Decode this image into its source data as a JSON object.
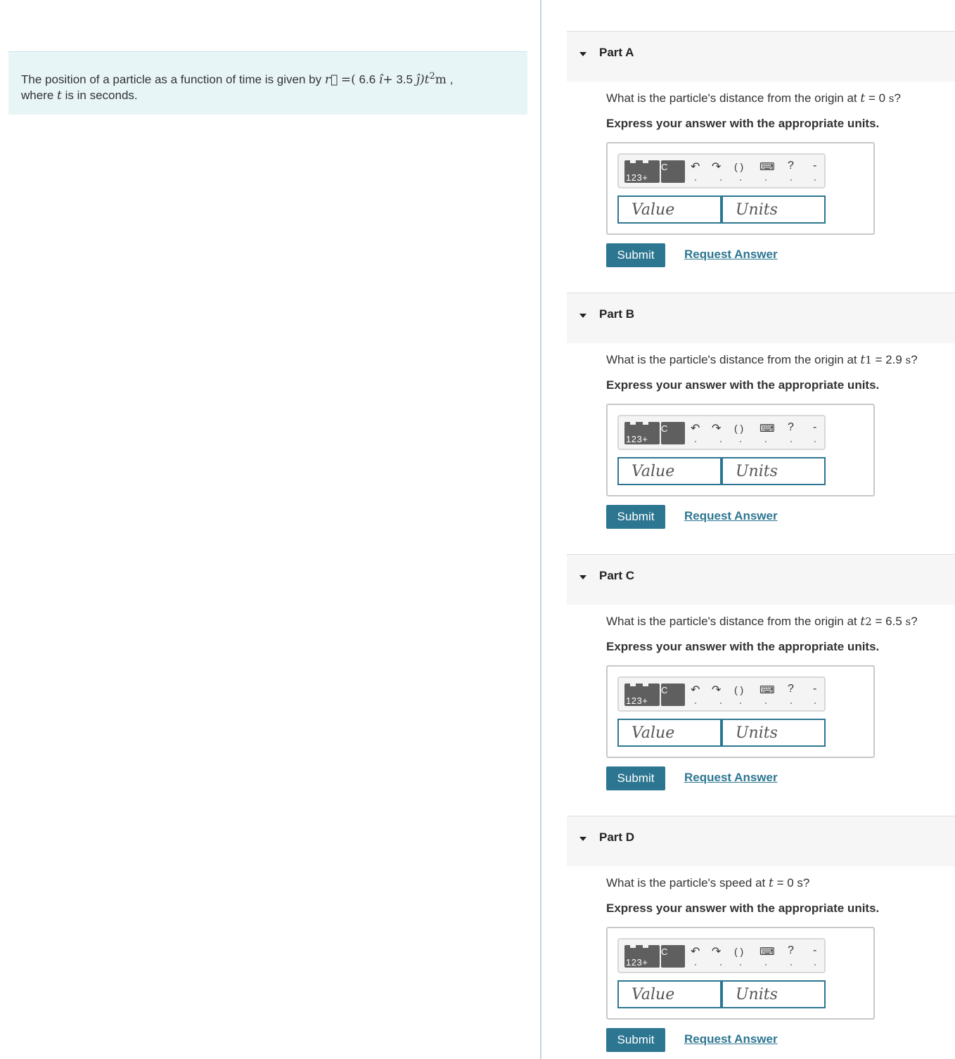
{
  "problem": {
    "intro": "The position of a particle as a function of time is given by",
    "r_symbol": "r⃗",
    "eq": "=(",
    "coef_i": "6.6",
    "i_hat": "î",
    "plus": "+",
    "coef_j": "3.5",
    "j_hat": "ĵ",
    "close": ")t",
    "exp": "2",
    "unit": "m",
    "comma": ",",
    "where": "where",
    "t": "t",
    "rest": "is in seconds."
  },
  "answer_ui": {
    "keypad_label": "123+",
    "template_label": "C",
    "undo_icon": "↶",
    "redo_icon": "↷",
    "reset_icon": "( )",
    "keyboard_icon": "⌨",
    "help_icon": "?",
    "dash_icon": "-",
    "value_placeholder": "Value",
    "units_placeholder": "Units",
    "submit_label": "Submit",
    "request_label": "Request Answer",
    "instruction": "Express your answer with the appropriate units."
  },
  "parts": [
    {
      "title": "Part A",
      "q_prefix": "What is the particle's distance from the origin at",
      "q_var": "t",
      "q_sub": "",
      "q_eq": "= 0",
      "q_unit": "s",
      "q_suffix": "?"
    },
    {
      "title": "Part B",
      "q_prefix": "What is the particle's distance from the origin at",
      "q_var": "t",
      "q_sub": "1",
      "q_eq": "= 2.9",
      "q_unit": "s",
      "q_suffix": "?"
    },
    {
      "title": "Part C",
      "q_prefix": "What is the particle's distance from the origin at",
      "q_var": "t",
      "q_sub": "2",
      "q_eq": "= 6.5",
      "q_unit": "s",
      "q_suffix": "?"
    },
    {
      "title": "Part D",
      "q_prefix": "What is the particle's speed at",
      "q_var": "t",
      "q_sub": "",
      "q_eq": "= 0",
      "q_unit": "",
      "q_suffix": "s?"
    }
  ],
  "colors": {
    "accent": "#2d7691",
    "problem_bg": "#e8f5f7",
    "header_bg": "#f6f6f6"
  }
}
